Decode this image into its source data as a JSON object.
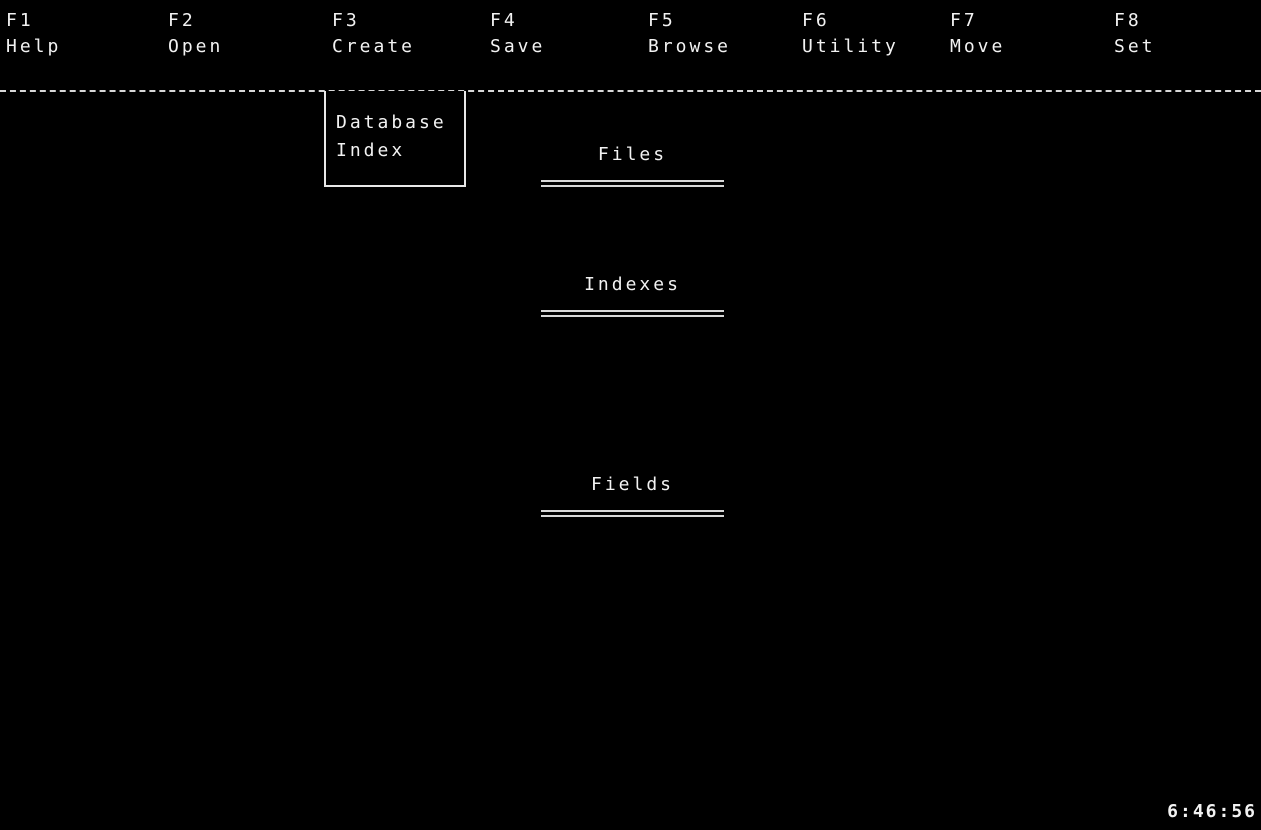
{
  "menu": [
    {
      "key": "F1",
      "label": "Help"
    },
    {
      "key": "F2",
      "label": "Open"
    },
    {
      "key": "F3",
      "label": "Create"
    },
    {
      "key": "F4",
      "label": "Save"
    },
    {
      "key": "F5",
      "label": "Browse"
    },
    {
      "key": "F6",
      "label": "Utility"
    },
    {
      "key": "F7",
      "label": "Move"
    },
    {
      "key": "F8",
      "label": "Set"
    }
  ],
  "create_menu": {
    "items": [
      "Database",
      "Index"
    ]
  },
  "sections": {
    "files": "Files",
    "indexes": "Indexes",
    "fields": "Fields"
  },
  "status": {
    "clock": "6:46:56"
  },
  "colors": {
    "background": "#000000",
    "text": "#f2f2f2"
  }
}
